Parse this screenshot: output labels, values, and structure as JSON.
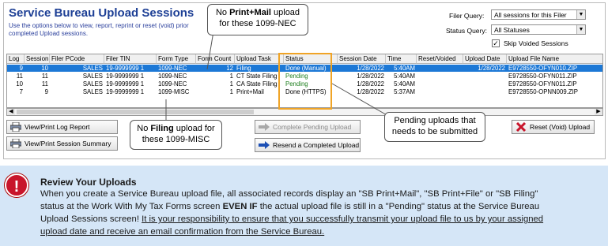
{
  "window": {
    "title": "Service Bureau Upload Sessions",
    "desc_line1": "Use the options below to view, report, reprint or reset (void) prior",
    "desc_line2": "completed Upload sessions.",
    "filer_query_label": "Filer Query:",
    "filer_query_value": "All sessions for this Filer",
    "status_query_label": "Status Query:",
    "status_query_value": "All Statuses",
    "skip_voided_label": "Skip Voided Sessions",
    "skip_voided_checked": true
  },
  "grid": {
    "headers": [
      "Log",
      "Session",
      "Filer PCode",
      "Filer TIN",
      "Form Type",
      "Form Count",
      "Upload Task",
      "Status",
      "Session Date",
      "Time",
      "Reset/Voided",
      "Upload Date",
      "Upload File Name"
    ],
    "rows": [
      {
        "log": "9",
        "session": "10",
        "pcode": "SALES",
        "tin": "19-9999999  1",
        "form": "1099-NEC",
        "count": "12",
        "task": "Filing",
        "status": "Done (Manual)",
        "date": "1/28/2022",
        "time": "5:40AM",
        "reset": "",
        "udate": "1/28/2022",
        "file": "E9728550-OFYN010.ZIP",
        "selected": true
      },
      {
        "log": "11",
        "session": "11",
        "pcode": "SALES",
        "tin": "19-9999999  1",
        "form": "1099-NEC",
        "count": "1",
        "task": "CT State Filing",
        "status": "Pending",
        "date": "1/28/2022",
        "time": "5:40AM",
        "reset": "",
        "udate": "",
        "file": "E9728550-OFYN011.ZIP",
        "selected": false
      },
      {
        "log": "10",
        "session": "11",
        "pcode": "SALES",
        "tin": "19-9999999  1",
        "form": "1099-NEC",
        "count": "1",
        "task": "CA State Filing",
        "status": "Pending",
        "date": "1/28/2022",
        "time": "5:40AM",
        "reset": "",
        "udate": "",
        "file": "E9728550-OFYN011.ZIP",
        "selected": false
      },
      {
        "log": "7",
        "session": "9",
        "pcode": "SALES",
        "tin": "19-9999999  1",
        "form": "1099-MISC",
        "count": "1",
        "task": "Print+Mail",
        "status": "Done (HTTPS)",
        "date": "1/28/2022",
        "time": "5:37AM",
        "reset": "",
        "udate": "",
        "file": "E9728550-OPNN009.ZIP",
        "selected": false
      }
    ]
  },
  "buttons": {
    "view_print_log": "View/Print Log Report",
    "view_print_session": "View/Print Session Summary",
    "complete_pending": "Complete Pending Upload",
    "resend_completed": "Resend a Completed Upload",
    "reset_void": "Reset (Void) Upload"
  },
  "callouts": {
    "nec_pre": "No ",
    "nec_bold": "Print+Mail",
    "nec_post": " upload",
    "nec_line2": "for these 1099-NEC",
    "misc_pre": "No ",
    "misc_bold": "Filing",
    "misc_post": " upload for",
    "misc_line2": "these 1099-MISC",
    "pending_line1": "Pending uploads that",
    "pending_line2": "needs to be submitted"
  },
  "notice": {
    "title": "Review Your Uploads",
    "line1": "When you create a Service Bureau upload file, all associated records display an \"SB Print+Mail\", \"SB Print+File\" or \"SB Filing\"",
    "line2_a": "status at the Work With My Tax Forms screen ",
    "line2_bold": "EVEN IF",
    "line2_b": " the actual upload file is still in a \"Pending\" status at the Service Bureau",
    "line3_a": "Upload Sessions screen! ",
    "line3_u": "It is your responsibility to ensure that you successfully transmit your upload file to us by your assigned",
    "line4_u": "upload date and receive an email confirmation from the Service Bureau."
  },
  "colors": {
    "title_blue": "#1d3f95",
    "selection_blue": "#1c78d6",
    "pending_green": "#1e7f1e",
    "highlight_orange": "#f0a426",
    "notice_bg": "#d5e6f7",
    "alert_red": "#c8152b"
  }
}
